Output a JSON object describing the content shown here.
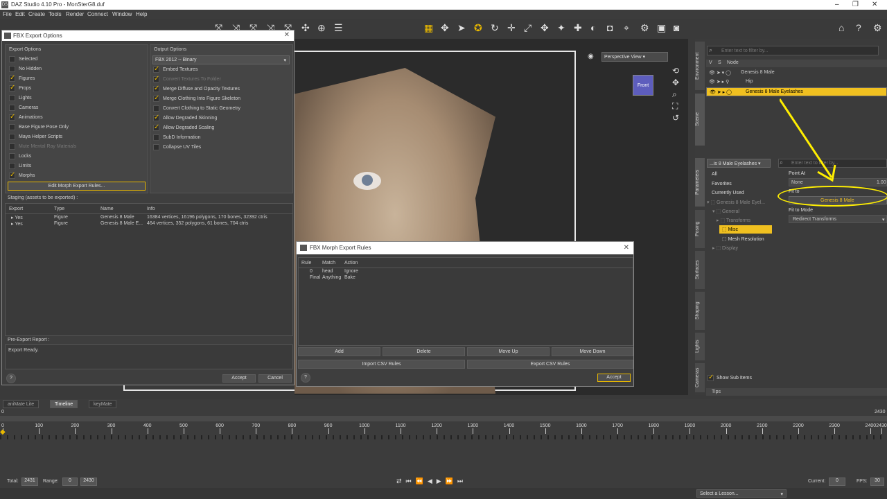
{
  "app": {
    "title": "DAZ Studio 4.10 Pro - MonSterG8.duf",
    "icon_label": "DS"
  },
  "menu": [
    "File",
    "Edit",
    "Create",
    "Tools",
    "Render",
    "Connect",
    "Window",
    "Help"
  ],
  "viewport": {
    "camera": "Perspective View",
    "cube_label": "Front"
  },
  "fbx_dialog": {
    "title": "FBX Export Options",
    "export_options_title": "Export Options",
    "export_options": [
      {
        "label": "Selected",
        "checked": false,
        "enabled": true
      },
      {
        "label": "No Hidden",
        "checked": false,
        "enabled": true
      },
      {
        "label": "Figures",
        "checked": true,
        "enabled": true
      },
      {
        "label": "Props",
        "checked": true,
        "enabled": true
      },
      {
        "label": "Lights",
        "checked": false,
        "enabled": true
      },
      {
        "label": "Cameras",
        "checked": false,
        "enabled": true
      },
      {
        "label": "Animations",
        "checked": true,
        "enabled": true
      },
      {
        "label": "Base Figure Pose Only",
        "checked": false,
        "enabled": true
      },
      {
        "label": "Maya Helper Scripts",
        "checked": false,
        "enabled": true
      },
      {
        "label": "Mute Mental Ray Materials",
        "checked": false,
        "enabled": false
      },
      {
        "label": "Locks",
        "checked": false,
        "enabled": true
      },
      {
        "label": "Limits",
        "checked": false,
        "enabled": true
      },
      {
        "label": "Morphs",
        "checked": true,
        "enabled": true
      }
    ],
    "edit_morph_button": "Edit Morph Export Rules...",
    "output_options_title": "Output Options",
    "format": "FBX 2012 -- Binary",
    "output_options": [
      {
        "label": "Embed Textures",
        "checked": true,
        "enabled": true
      },
      {
        "label": "Convert Textures To Folder",
        "checked": true,
        "enabled": false
      },
      {
        "label": "Merge Diffuse and Opacity Textures",
        "checked": true,
        "enabled": true
      },
      {
        "label": "Merge Clothing Into Figure Skeleton",
        "checked": true,
        "enabled": true
      },
      {
        "label": "Convert Clothing to Static Geometry",
        "checked": false,
        "enabled": true
      },
      {
        "label": "Allow Degraded Skinning",
        "checked": true,
        "enabled": true
      },
      {
        "label": "Allow Degraded Scaling",
        "checked": true,
        "enabled": true
      },
      {
        "label": "SubD Information",
        "checked": false,
        "enabled": true
      },
      {
        "label": "Collapse UV Tiles",
        "checked": false,
        "enabled": true
      }
    ],
    "staging_title": "Staging (assets to be exported) :",
    "staging_headers": [
      "Export",
      "Type",
      "Name",
      "Info"
    ],
    "staging_rows": [
      {
        "export": "Yes",
        "type": "Figure",
        "name": "Genesis 8 Male",
        "info": "16384 vertices, 16196 polygons, 170 bones, 32392 ctris"
      },
      {
        "export": "Yes",
        "type": "Figure",
        "name": "Genesis 8 Male E...",
        "info": "464 vertices, 352 polygons, 61 bones, 704 ctris"
      }
    ],
    "report_title": "Pre-Export Report :",
    "report_text": "Export Ready.",
    "help": "?",
    "accept": "Accept",
    "cancel": "Cancel"
  },
  "morph_dialog": {
    "title": "FBX Morph Export Rules",
    "headers": [
      "Rule",
      "Match",
      "Action"
    ],
    "rows": [
      {
        "rule": "0",
        "match": "head",
        "action": "Ignore"
      },
      {
        "rule": "Final",
        "match": "Anything",
        "action": "Bake"
      }
    ],
    "buttons": {
      "add": "Add",
      "delete": "Delete",
      "move_up": "Move Up",
      "move_down": "Move Down",
      "import_csv": "Import CSV Rules",
      "export_csv": "Export CSV Rules",
      "accept": "Accept",
      "help": "?"
    }
  },
  "scene": {
    "filter_placeholder": "Enter text to filter by...",
    "col_v": "V",
    "col_s": "S",
    "col_node": "Node",
    "nodes": [
      "Genesis 8 Male",
      "Hip",
      "Genesis 8 Male Eyelashes"
    ],
    "tab_environment": "Environment",
    "tab_scene": "Scene"
  },
  "parameters": {
    "node_select": "...is 8 Male Eyelashes",
    "filter_placeholder": "Enter text to filter by...",
    "groups": [
      "All",
      "Favorites",
      "Currently Used"
    ],
    "tree": [
      "Genesis 8 Male Eyel...",
      "General",
      "Transforms",
      "Misc",
      "Mesh Resolution",
      "Display"
    ],
    "props": {
      "point_at": "Point At",
      "none": "None",
      "fit_to": "Fit to",
      "fit_to_value": "Genesis 8 Male",
      "fit_to_mode": "Fit to Mode",
      "fit_mode_value": "Redirect Transforms",
      "lod": "1.00"
    },
    "show_sub_items": "Show Sub Items",
    "tips": "Tips",
    "side_tabs": [
      "Parameters",
      "Posing",
      "Surfaces",
      "Shaping",
      "Lights",
      "Cameras"
    ]
  },
  "timeline": {
    "tabs": [
      "aniMate Lite",
      "Timeline",
      "keyMate"
    ],
    "start": "0",
    "end": "2430",
    "ticks": [
      "0",
      "100",
      "200",
      "300",
      "400",
      "500",
      "600",
      "700",
      "800",
      "900",
      "1000",
      "1100",
      "1200",
      "1300",
      "1400",
      "1500",
      "1600",
      "1700",
      "1800",
      "1900",
      "2000",
      "2100",
      "2200",
      "2300",
      "2400",
      "2430"
    ],
    "total_label": "Total:",
    "total": "2431",
    "range_label": "Range:",
    "range_start": "0",
    "range_end": "2430",
    "current_label": "Current:",
    "current": "0",
    "fps_label": "FPS:",
    "fps": "30"
  },
  "status": {
    "lesson": "Select a Lesson..."
  },
  "colors": {
    "accent": "#e8b800",
    "highlight": "#f0c020",
    "annotation": "#ffee00"
  }
}
